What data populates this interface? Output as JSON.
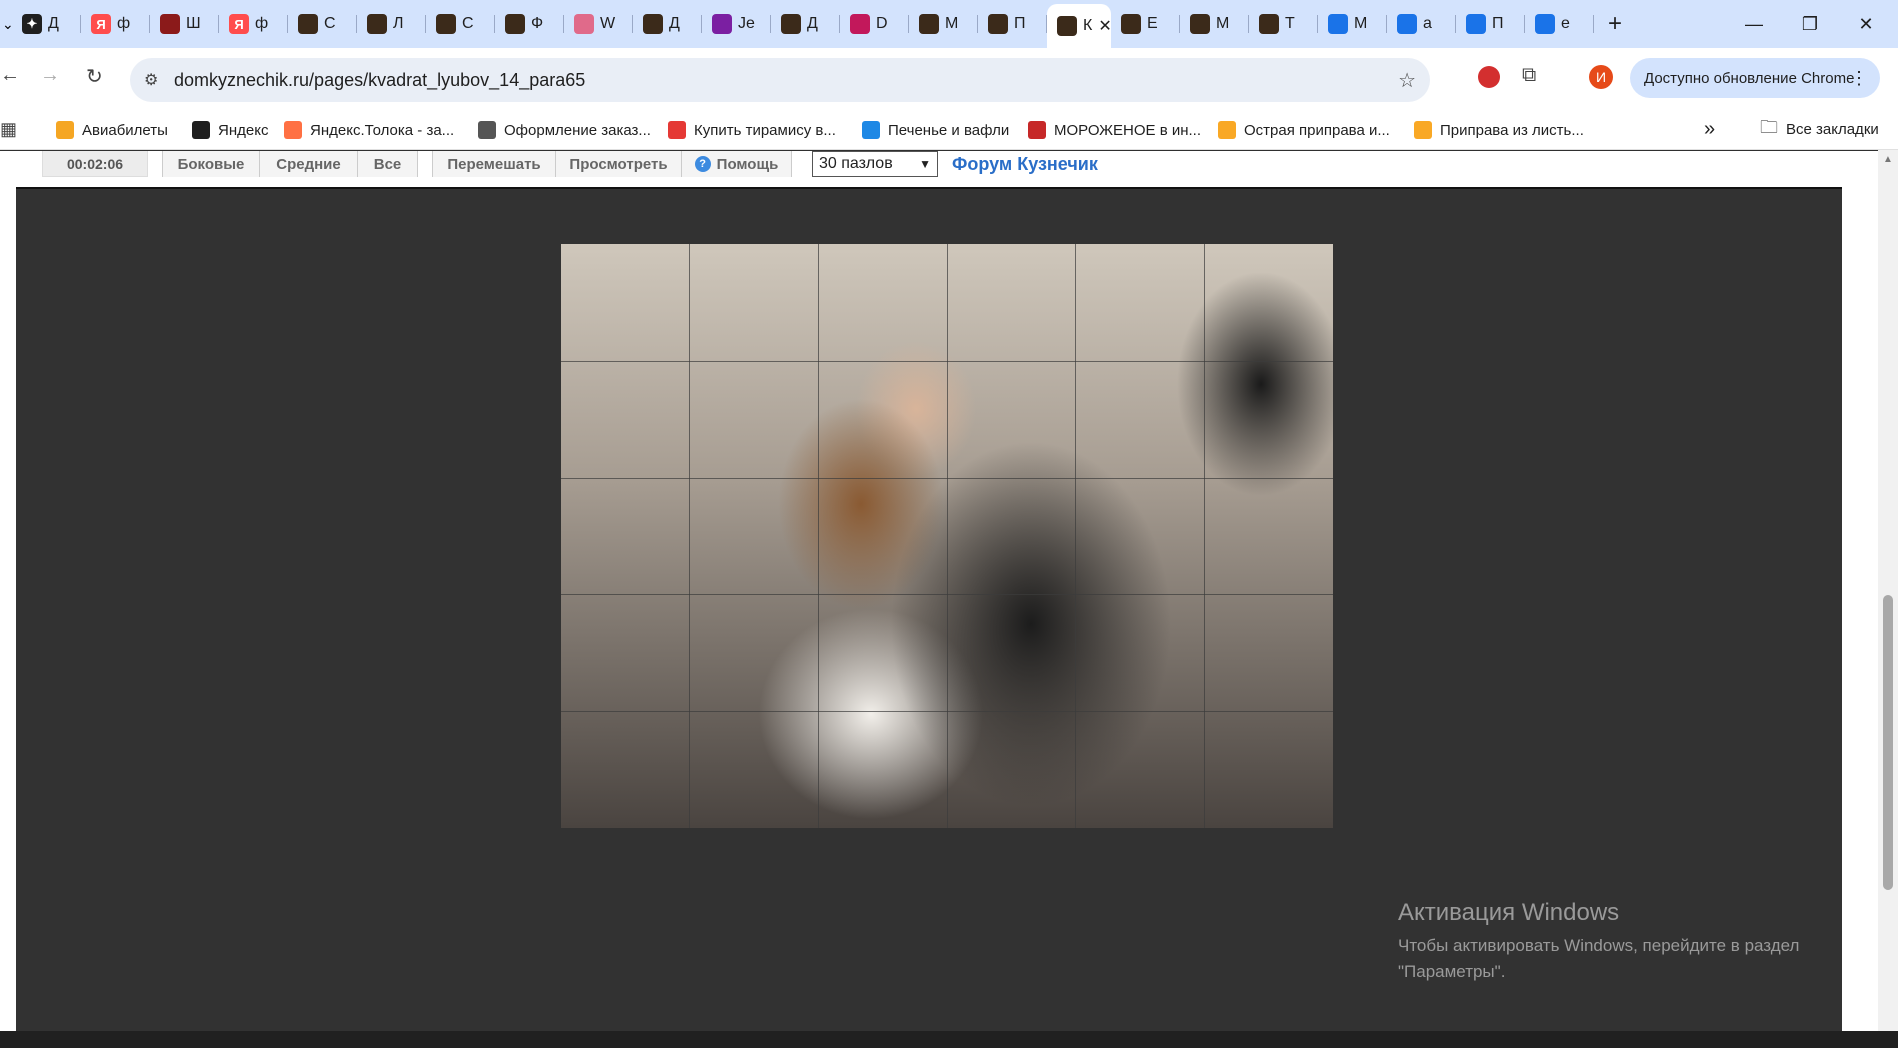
{
  "tabs": [
    {
      "label": "Д",
      "color": "#1f1f1f",
      "glyph": "✦"
    },
    {
      "label": "ф",
      "color": "#ff4d4d",
      "glyph": "Я"
    },
    {
      "label": "Ш",
      "color": "#8b1a1a",
      "glyph": ""
    },
    {
      "label": "ф",
      "color": "#ff4d4d",
      "glyph": "Я"
    },
    {
      "label": "С",
      "color": "#3b2a1a",
      "glyph": ""
    },
    {
      "label": "Л",
      "color": "#3b2a1a",
      "glyph": ""
    },
    {
      "label": "С",
      "color": "#3b2a1a",
      "glyph": ""
    },
    {
      "label": "Ф",
      "color": "#3b2a1a",
      "glyph": ""
    },
    {
      "label": "W",
      "color": "#e06a8a",
      "glyph": ""
    },
    {
      "label": "Д",
      "color": "#3b2a1a",
      "glyph": ""
    },
    {
      "label": "Je",
      "color": "#7b1fa2",
      "glyph": ""
    },
    {
      "label": "Д",
      "color": "#3b2a1a",
      "glyph": ""
    },
    {
      "label": "D",
      "color": "#c2185b",
      "glyph": ""
    },
    {
      "label": "М",
      "color": "#3b2a1a",
      "glyph": ""
    },
    {
      "label": "П",
      "color": "#3b2a1a",
      "glyph": ""
    }
  ],
  "active_tab": {
    "label": "К",
    "close": "✕"
  },
  "tabs_after": [
    {
      "label": "Е",
      "color": "#3b2a1a"
    },
    {
      "label": "М",
      "color": "#3b2a1a"
    },
    {
      "label": "Т",
      "color": "#3b2a1a"
    },
    {
      "label": "М",
      "color": "#1a73e8"
    },
    {
      "label": "а",
      "color": "#1a73e8"
    },
    {
      "label": "П",
      "color": "#1a73e8"
    },
    {
      "label": "е",
      "color": "#1a73e8"
    }
  ],
  "new_tab": "+",
  "window": {
    "minimize": "—",
    "restore": "❐",
    "close": "✕"
  },
  "address": {
    "url": "domkyznechik.ru/pages/kvadrat_lyubov_14_para65"
  },
  "profile_initial": "И",
  "update_button": "Доступно обновление Chrome",
  "bookmarks": [
    {
      "label": "Авиабилеты",
      "color": "#f5a623"
    },
    {
      "label": "Яндекс",
      "color": "#1f1f1f"
    },
    {
      "label": "Яндекс.Толока - за...",
      "color": "#ff7043"
    },
    {
      "label": "Оформление заказ...",
      "color": "#555555"
    },
    {
      "label": "Купить тирамису в...",
      "color": "#e53935"
    },
    {
      "label": "Печенье и вафли",
      "color": "#1e88e5"
    },
    {
      "label": "МОРОЖЕНОЕ в ин...",
      "color": "#c62828"
    },
    {
      "label": "Острая приправа и...",
      "color": "#f9a825"
    },
    {
      "label": "Приправа из листь...",
      "color": "#f9a825"
    }
  ],
  "bookmarks_more": "»",
  "all_bookmarks": "Все закладки",
  "puzzle": {
    "timer": "00:02:06",
    "buttons": [
      "Боковые",
      "Средние",
      "Все"
    ],
    "buttons2": [
      "Перемешать",
      "Просмотреть",
      "Помощь"
    ],
    "pieces_select": "30 пазлов",
    "forum_link": "Форум Кузнечик"
  },
  "activation": {
    "title": "Активация Windows",
    "line1": "Чтобы активировать Windows, перейдите в раздел",
    "line2": "\"Параметры\"."
  }
}
